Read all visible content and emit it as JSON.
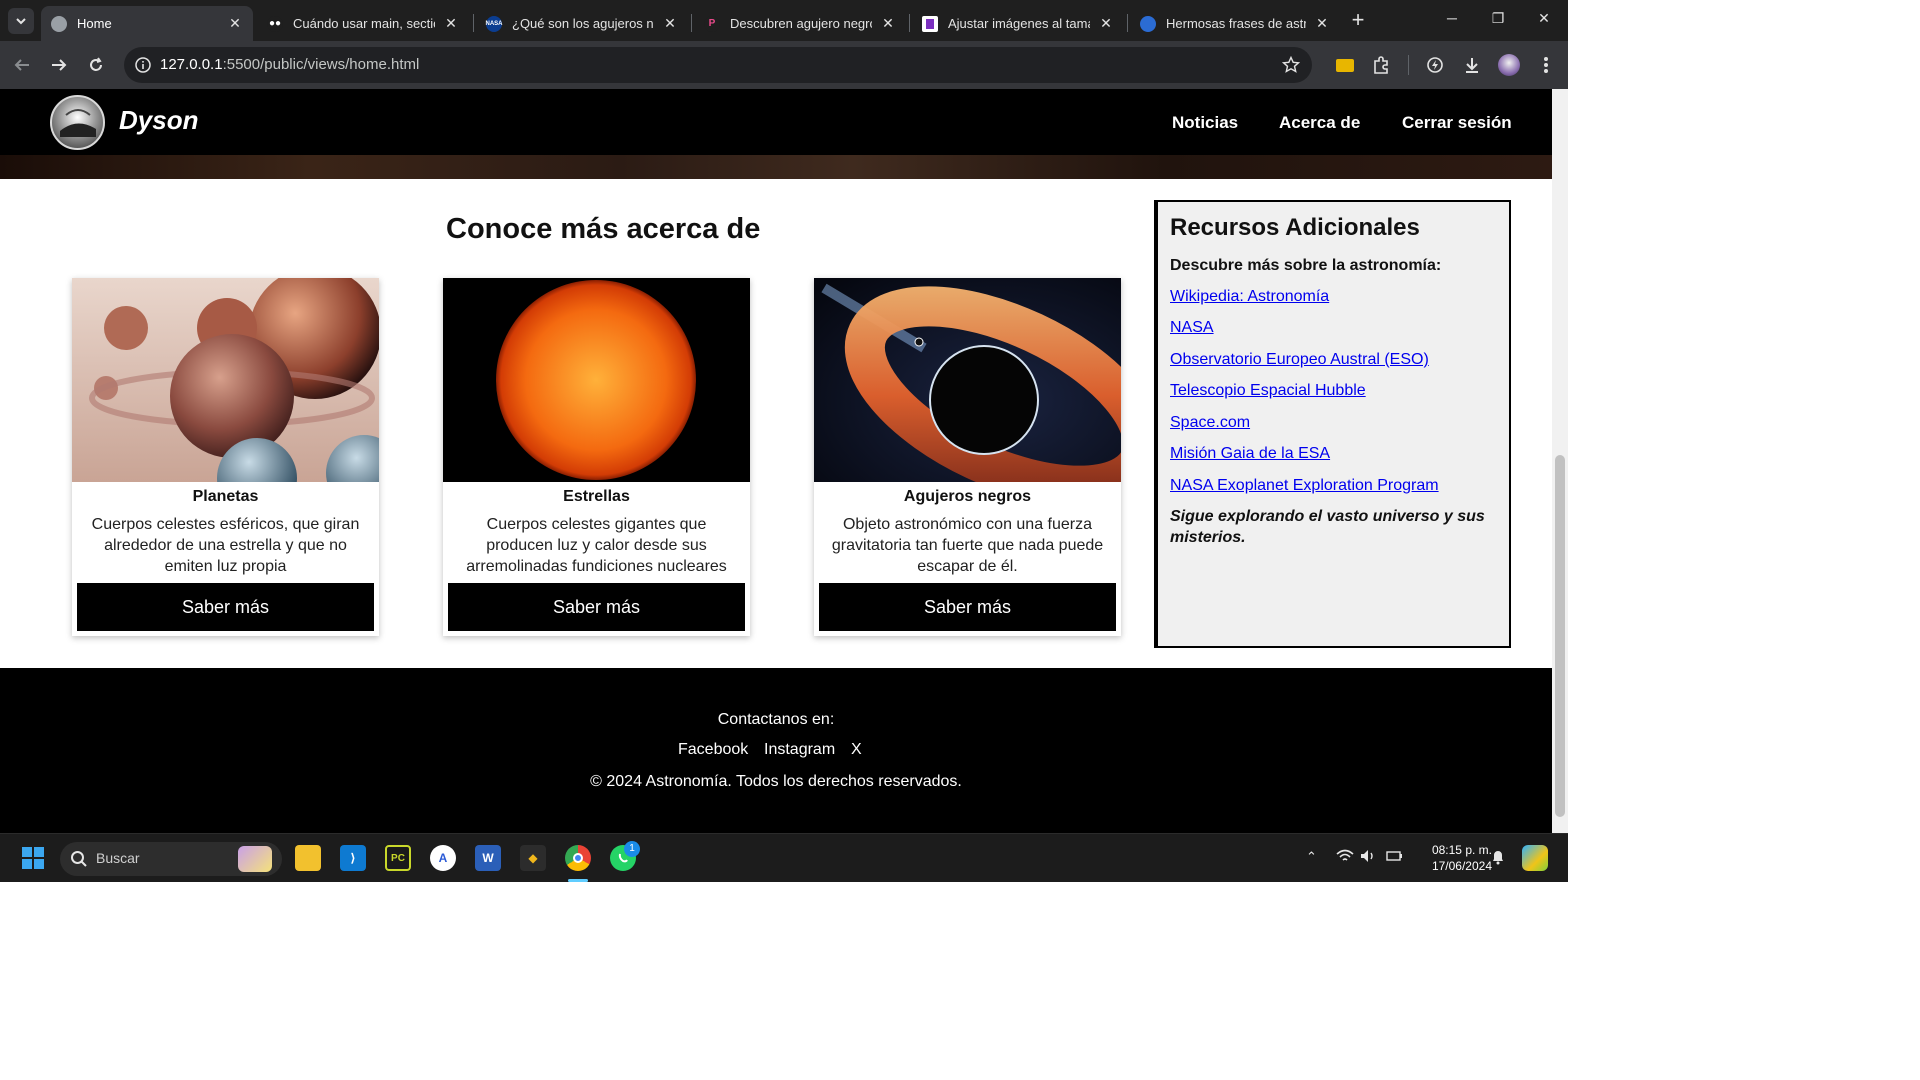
{
  "browser": {
    "tabs": [
      {
        "title": "Home",
        "favicon": "globe-icon",
        "active": true
      },
      {
        "title": "Cuándo usar main, section, article",
        "favicon": "medium-icon",
        "active": false
      },
      {
        "title": "¿Qué son los agujeros negros?",
        "favicon": "nasa-icon",
        "active": false
      },
      {
        "title": "Descubren agujero negro con masa",
        "favicon": "p-icon",
        "active": false
      },
      {
        "title": "Ajustar imágenes al tamaño del div",
        "favicon": "flag-icon",
        "active": false
      },
      {
        "title": "Hermosas frases de astronomía",
        "favicon": "globe-blue-icon",
        "active": false
      }
    ],
    "url": {
      "host": "127.0.0.1",
      "rest": ":5500/public/views/home.html"
    }
  },
  "site": {
    "brand": "Dyson",
    "nav": [
      "Noticias",
      "Acerca de",
      "Cerrar sesión"
    ],
    "section_title": "Conoce más acerca de",
    "cards": [
      {
        "title": "Planetas",
        "description": "Cuerpos celestes esféricos, que giran alrededor de una estrella y que no emiten luz propia",
        "button": "Saber más"
      },
      {
        "title": "Estrellas",
        "description": "Cuerpos celestes gigantes que producen luz y calor desde sus arremolinadas fundiciones nucleares",
        "button": "Saber más"
      },
      {
        "title": "Agujeros negros",
        "description": "Objeto astronómico con una fuerza gravitatoria tan fuerte que nada puede escapar de él.",
        "button": "Saber más"
      }
    ],
    "aside": {
      "title": "Recursos Adicionales",
      "lead": "Descubre más sobre la astronomía:",
      "links": [
        "Wikipedia: Astronomía",
        "NASA",
        "Observatorio Europeo Austral (ESO)",
        "Telescopio Espacial Hubble",
        "Space.com",
        "Misión Gaia de la ESA",
        "NASA Exoplanet Exploration Program"
      ],
      "closing": "Sigue explorando el vasto universo y sus misterios."
    },
    "footer": {
      "contact": "Contactanos en:",
      "social": [
        "Facebook",
        "Instagram",
        "X"
      ],
      "copyright": "© 2024 Astronomía. Todos los derechos reservados."
    }
  },
  "taskbar": {
    "search_placeholder": "Buscar",
    "time": "08:15 p. m.",
    "date": "17/06/2024",
    "whatsapp_badge": "1"
  }
}
